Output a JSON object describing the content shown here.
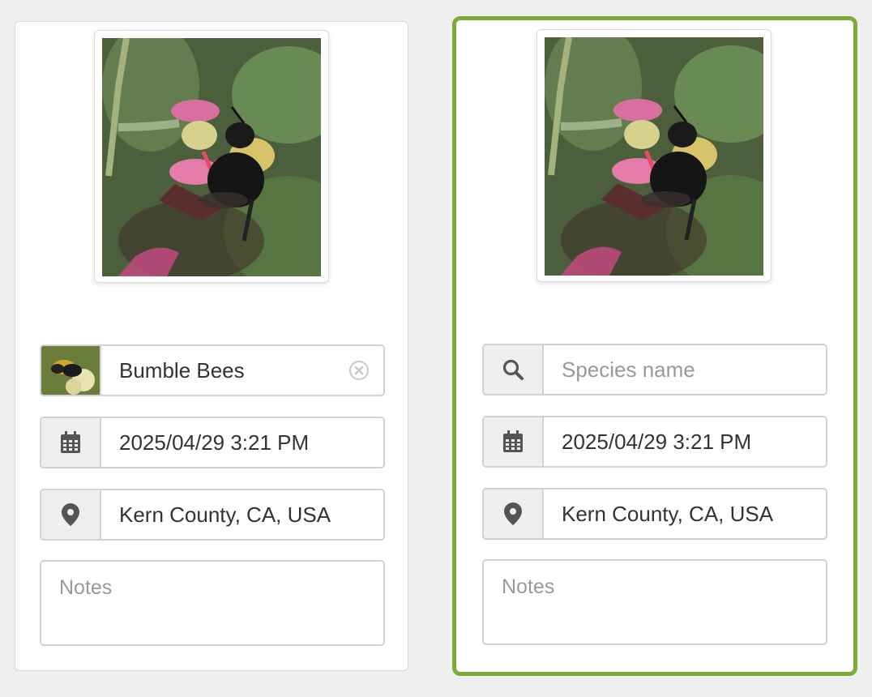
{
  "cards": [
    {
      "taxon": "Bumble Bees",
      "datetime": "2025/04/29 3:21 PM",
      "location": "Kern County, CA, USA",
      "notes_placeholder": "Notes",
      "icons": {
        "taxon": "bumble-bee-thumbnail",
        "clear": "clear-circle-icon",
        "date": "calendar-icon",
        "location": "map-pin-icon"
      }
    },
    {
      "taxon_placeholder": "Species name",
      "datetime": "2025/04/29 3:21 PM",
      "location": "Kern County, CA, USA",
      "notes_placeholder": "Notes",
      "icons": {
        "taxon": "search-icon",
        "date": "calendar-icon",
        "location": "map-pin-icon"
      }
    }
  ],
  "colors": {
    "selected_border": "#7dab39",
    "addon_bg": "#efefef",
    "field_border": "#d2d2d2"
  }
}
